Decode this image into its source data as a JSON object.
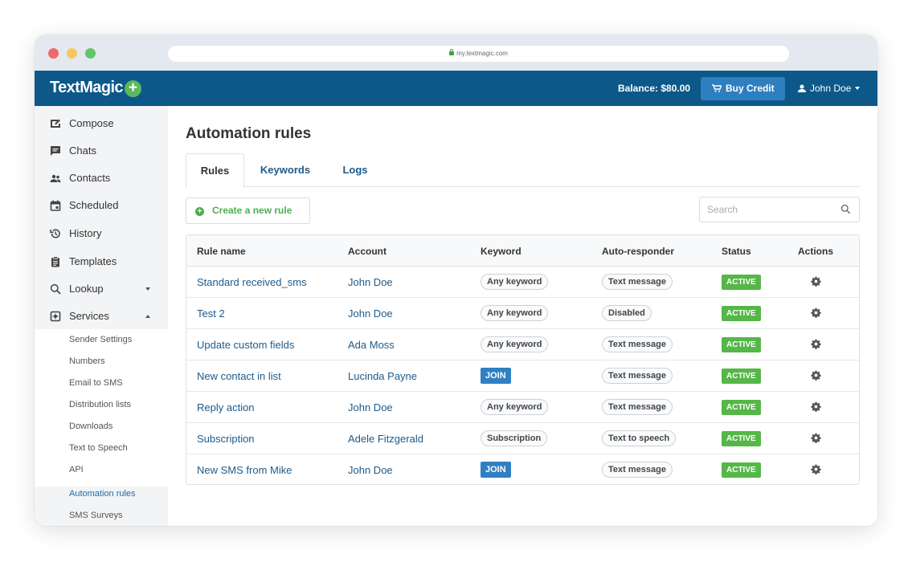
{
  "browser": {
    "url": "my.textmagic.com"
  },
  "header": {
    "logo": "TextMagic",
    "balance": "Balance: $80.00",
    "buy_credit": "Buy Credit",
    "user": "John Doe"
  },
  "sidebar": {
    "items": [
      {
        "label": "Compose",
        "icon": "compose-icon"
      },
      {
        "label": "Chats",
        "icon": "chat-icon"
      },
      {
        "label": "Contacts",
        "icon": "contacts-icon"
      },
      {
        "label": "Scheduled",
        "icon": "calendar-icon"
      },
      {
        "label": "History",
        "icon": "history-icon"
      },
      {
        "label": "Templates",
        "icon": "clipboard-icon"
      },
      {
        "label": "Lookup",
        "icon": "search-icon"
      },
      {
        "label": "Services",
        "icon": "services-icon"
      }
    ],
    "services_sub": [
      "Sender Settings",
      "Numbers",
      "Email to SMS",
      "Distribution lists",
      "Downloads",
      "Text to Speech",
      "API",
      "Automation rules",
      "SMS Surveys"
    ],
    "active_sub": "Automation rules"
  },
  "main": {
    "title": "Automation rules",
    "tabs": [
      "Rules",
      "Keywords",
      "Logs"
    ],
    "active_tab": "Rules",
    "create_button": "Create a new rule",
    "search_placeholder": "Search",
    "columns": [
      "Rule name",
      "Account",
      "Keyword",
      "Auto-responder",
      "Status",
      "Actions"
    ],
    "rows": [
      {
        "name": "Standard received_sms",
        "account": "John Doe",
        "keyword": "Any keyword",
        "keyword_type": "pill",
        "responder": "Text message",
        "status": "ACTIVE"
      },
      {
        "name": "Test 2",
        "account": "John Doe",
        "keyword": "Any keyword",
        "keyword_type": "pill",
        "responder": "Disabled",
        "status": "ACTIVE"
      },
      {
        "name": "Update custom fields",
        "account": "Ada Moss",
        "keyword": "Any keyword",
        "keyword_type": "pill",
        "responder": "Text message",
        "status": "ACTIVE"
      },
      {
        "name": "New contact in list",
        "account": "Lucinda Payne",
        "keyword": "JOIN",
        "keyword_type": "join",
        "responder": "Text message",
        "status": "ACTIVE"
      },
      {
        "name": "Reply action",
        "account": "John Doe",
        "keyword": "Any keyword",
        "keyword_type": "pill",
        "responder": "Text message",
        "status": "ACTIVE"
      },
      {
        "name": "Subscription",
        "account": "Adele Fitzgerald",
        "keyword": "Subscription",
        "keyword_type": "pill",
        "responder": "Text to speech",
        "status": "ACTIVE"
      },
      {
        "name": "New SMS from Mike",
        "account": "John Doe",
        "keyword": "JOIN",
        "keyword_type": "join",
        "responder": "Text message",
        "status": "ACTIVE"
      }
    ]
  },
  "colors": {
    "header_bg": "#0c5889",
    "buy_button": "#2e7fc0",
    "link": "#1e5a8a",
    "active_status": "#55b748",
    "join_badge": "#2f80c2",
    "create_green": "#4eae4e"
  }
}
